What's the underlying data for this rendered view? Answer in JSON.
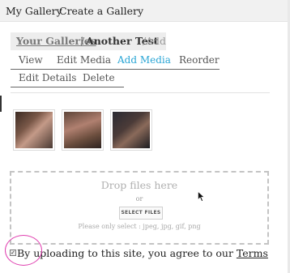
{
  "topnav": {
    "my_gallery": "My Gallery",
    "create_gallery": "Create a Gallery"
  },
  "breadcrumb": {
    "root": "Your Galleries",
    "separator": "/",
    "current": "Another Test",
    "tail_separator": "/",
    "tail": "Add"
  },
  "tabs_row1": [
    {
      "label": "View",
      "active": false
    },
    {
      "label": "Edit Media",
      "active": false
    },
    {
      "label": "Add Media",
      "active": true
    },
    {
      "label": "Reorder",
      "active": false
    }
  ],
  "tabs_row2": [
    {
      "label": "Edit Details"
    },
    {
      "label": "Delete"
    }
  ],
  "thumbnails": [
    {
      "name": "media-thumbnail-1"
    },
    {
      "name": "media-thumbnail-2"
    },
    {
      "name": "media-thumbnail-3"
    }
  ],
  "dropzone": {
    "title": "Drop files here",
    "or": "or",
    "button": "SELECT FILES",
    "hint": "Please only select : jpeg, jpg, gif, png"
  },
  "terms": {
    "checkbox_mark": "✓",
    "checked": true,
    "text": "By uploading to this site, you agree to our ",
    "link": "Terms"
  },
  "colors": {
    "active_tab": "#29a5d5",
    "annotation_circle": "#e040b0",
    "nav_bg": "#f1f1f1"
  }
}
